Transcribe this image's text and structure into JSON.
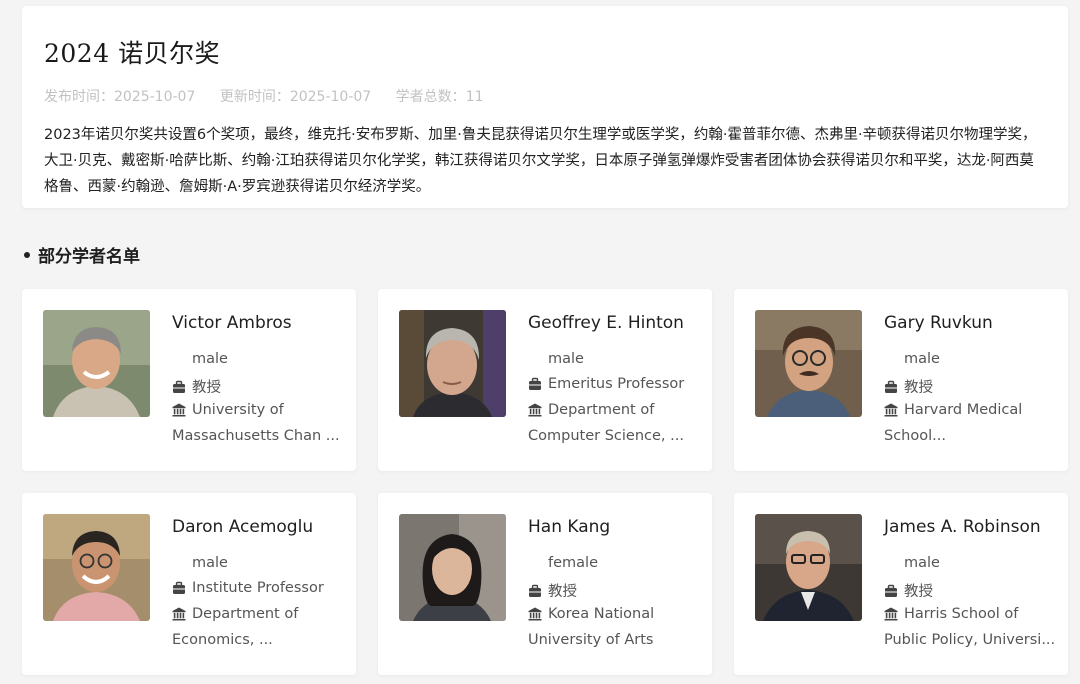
{
  "header": {
    "title": "2024 诺贝尔奖",
    "published_label": "发布时间：",
    "published_date": "2025-10-07",
    "updated_label": "更新时间：",
    "updated_date": "2025-10-07",
    "count_label": "学者总数：",
    "count_value": "11",
    "description": "2023年诺贝尔奖共设置6个奖项，最终，维克托·安布罗斯、加里·鲁夫昆获得诺贝尔生理学或医学奖，约翰·霍普菲尔德、杰弗里·辛顿获得诺贝尔物理学奖，大卫·贝克、戴密斯·哈萨比斯、约翰·江珀获得诺贝尔化学奖，韩江获得诺贝尔文学奖，日本原子弹氢弹爆炸受害者团体协会获得诺贝尔和平奖，达龙·阿西莫格鲁、西蒙·约翰逊、詹姆斯·A·罗宾逊获得诺贝尔经济学奖。"
  },
  "section": {
    "title": "部分学者名单"
  },
  "icons": {
    "title": "briefcase-icon",
    "institution": "bank-building-icon"
  },
  "scholars": [
    {
      "name": "Victor Ambros",
      "gender": "male",
      "title": "教授",
      "inst1": "University of",
      "inst2": "Massachusetts Chan ..."
    },
    {
      "name": "Geoffrey E. Hinton",
      "gender": "male",
      "title": "Emeritus Professor",
      "inst1": "Department of",
      "inst2": "Computer Science, ..."
    },
    {
      "name": "Gary Ruvkun",
      "gender": "male",
      "title": "教授",
      "inst1": "Harvard Medical",
      "inst2": "School..."
    },
    {
      "name": "Daron Acemoglu",
      "gender": "male",
      "title": "Institute Professor",
      "inst1": "Department of",
      "inst2": "Economics, ..."
    },
    {
      "name": "Han Kang",
      "gender": "female",
      "title": "教授",
      "inst1": "Korea National",
      "inst2": "University of Arts"
    },
    {
      "name": "James A. Robinson",
      "gender": "male",
      "title": "教授",
      "inst1": "Harris School of",
      "inst2": "Public Policy, Universi..."
    }
  ]
}
